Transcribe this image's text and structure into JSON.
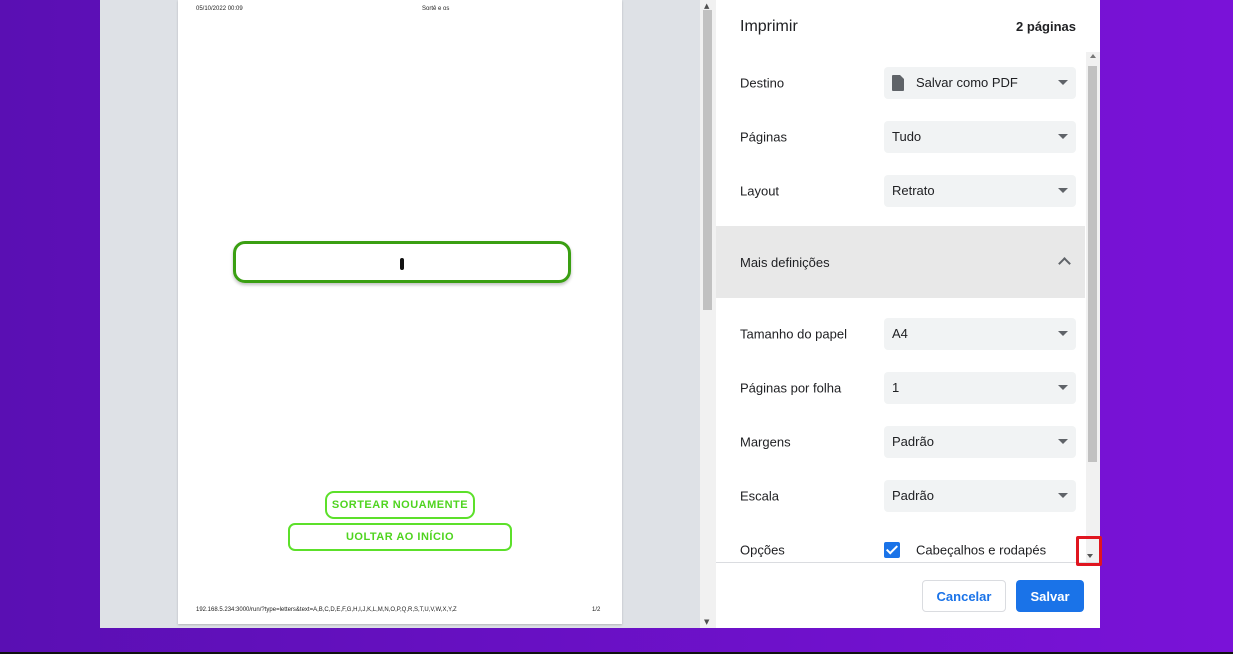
{
  "preview": {
    "header_date": "05/10/2022 00:09",
    "header_title": "Sortê e os",
    "footer_url": "192.168.5.234:3000/run/?type=letters&text=A,B,C,D,E,F,G,H,I,J,K,L,M,N,O,P,Q,R,S,T,U,V,W,X,Y,Z",
    "footer_page": "1/2",
    "button_draw_again": "SORTEAR NOUAMENTE",
    "button_back_home": "UOLTAR AO INÍCIO"
  },
  "settings": {
    "title": "Imprimir",
    "page_count": "2 páginas",
    "destination": {
      "label": "Destino",
      "value": "Salvar como PDF",
      "icon": "file-icon"
    },
    "pages": {
      "label": "Páginas",
      "value": "Tudo"
    },
    "layout": {
      "label": "Layout",
      "value": "Retrato"
    },
    "more_settings": {
      "label": "Mais definições"
    },
    "paper_size": {
      "label": "Tamanho do papel",
      "value": "A4"
    },
    "pages_per_sheet": {
      "label": "Páginas por folha",
      "value": "1"
    },
    "margins": {
      "label": "Margens",
      "value": "Padrão"
    },
    "scale": {
      "label": "Escala",
      "value": "Padrão"
    },
    "options": {
      "label": "Opções",
      "checkbox_label": "Cabeçalhos e rodapés",
      "checked": true
    }
  },
  "actions": {
    "cancel": "Cancelar",
    "save": "Salvar"
  },
  "colors": {
    "accent": "#1a73e8",
    "highlight": "#e0151f",
    "preview_green": "#4fd41f"
  }
}
